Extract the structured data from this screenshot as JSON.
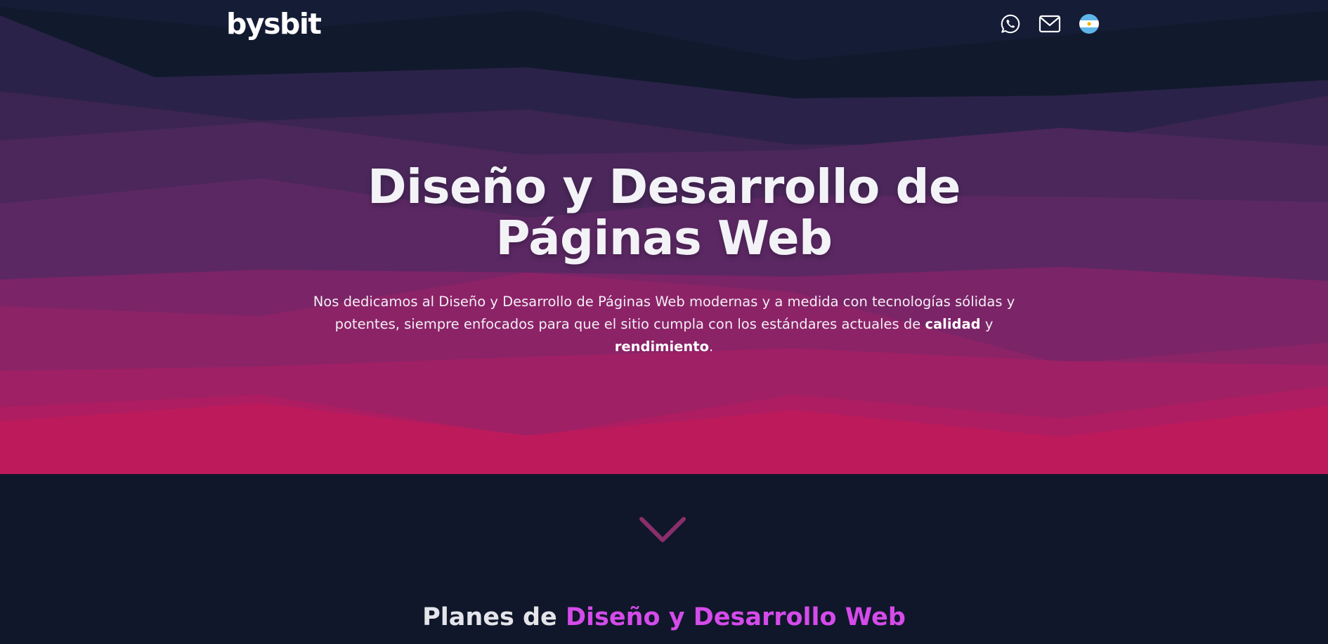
{
  "header": {
    "logo": "bysbit",
    "icons": [
      "whatsapp-icon",
      "mail-icon",
      "argentina-flag-icon"
    ]
  },
  "hero": {
    "title_line1": "Diseño y Desarrollo de",
    "title_line2": "Páginas Web",
    "text_part1": "Nos dedicamos al Diseño y Desarrollo de Páginas Web modernas y a medida con tecnologías sólidas y potentes, siempre enfocados para que el sitio cumpla con los estándares actuales de ",
    "text_bold1": "calidad",
    "text_part2": " y ",
    "text_bold2": "rendimiento",
    "text_part3": "."
  },
  "scroll_icon": "chevron-down-icon",
  "plans": {
    "title_plain": "Planes de ",
    "title_accent": "Diseño y Desarrollo Web"
  },
  "colors": {
    "page_bg": "#10172a",
    "hero_bottom": "#bd1a5c",
    "accent": "#d54bea",
    "chevron": "#8a2f6b"
  }
}
